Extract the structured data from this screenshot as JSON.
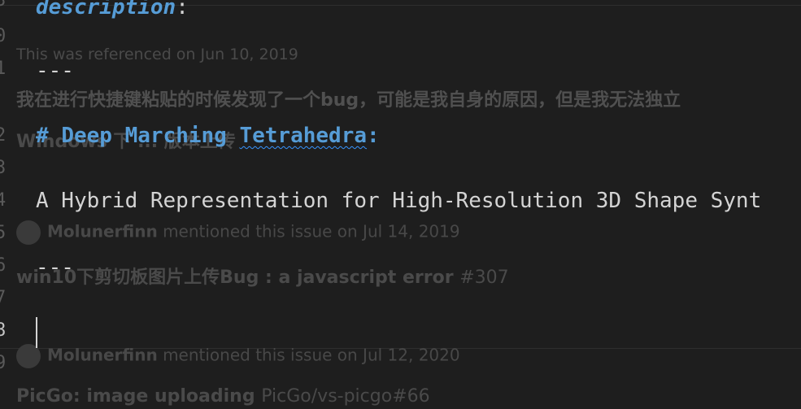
{
  "background_page": {
    "referenced_text": "This was referenced on Jun 10, 2019",
    "bug_report_text": "我在进行快捷键粘贴的时候发现了一个bug，可能是我自身的原因，但是我无法独立",
    "windows_text": "Windows 下 ... 版本上传",
    "mention1": {
      "user": "Molunerfinn",
      "text": "mentioned this issue on Jul 14, 2019"
    },
    "issue1": {
      "title": "win10下剪切板图片上传Bug : a javascript error",
      "number": "#307"
    },
    "mention2": {
      "user": "Molunerfinn",
      "text": "mentioned this issue on Jul 12, 2020"
    },
    "issue2": {
      "title": "PicGo: image uploading",
      "ref": "PicGo/vs-picgo#66"
    }
  },
  "editor": {
    "description_key": "description",
    "description_colon": ":",
    "separator": "---",
    "heading": {
      "hash": "# ",
      "word1": "Deep Marching ",
      "misspelled": "Tetrahedra",
      "colon": ":"
    },
    "body_line": "A Hybrid Representation for High-Resolution 3D Shape Synt",
    "gutter": [
      "3",
      "0",
      "1",
      "2",
      "3",
      "4",
      "5",
      "6",
      "7",
      "8",
      "9"
    ]
  },
  "colors": {
    "background": "#1e1e1e",
    "keyword": "#569cd6",
    "text": "#d4d4d4",
    "spell_squiggle": "#3794ff"
  }
}
